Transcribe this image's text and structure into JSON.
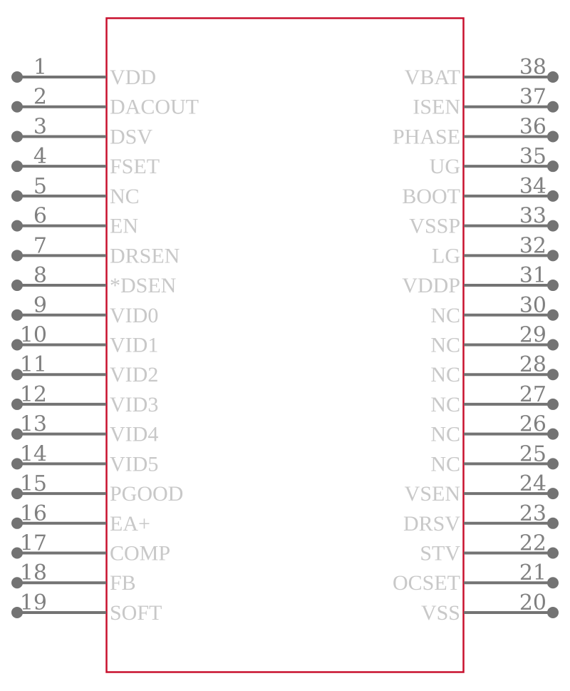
{
  "component": {
    "body_color": "#c8102e",
    "pin_color": "#737373",
    "label_color": "#c8c8c8",
    "left_pins": [
      {
        "number": "1",
        "name": "VDD"
      },
      {
        "number": "2",
        "name": "DACOUT"
      },
      {
        "number": "3",
        "name": "DSV"
      },
      {
        "number": "4",
        "name": "FSET"
      },
      {
        "number": "5",
        "name": "NC"
      },
      {
        "number": "6",
        "name": "EN"
      },
      {
        "number": "7",
        "name": "DRSEN"
      },
      {
        "number": "8",
        "name": "*DSEN"
      },
      {
        "number": "9",
        "name": "VID0"
      },
      {
        "number": "10",
        "name": "VID1"
      },
      {
        "number": "11",
        "name": "VID2"
      },
      {
        "number": "12",
        "name": "VID3"
      },
      {
        "number": "13",
        "name": "VID4"
      },
      {
        "number": "14",
        "name": "VID5"
      },
      {
        "number": "15",
        "name": "PGOOD"
      },
      {
        "number": "16",
        "name": "EA+"
      },
      {
        "number": "17",
        "name": "COMP"
      },
      {
        "number": "18",
        "name": "FB"
      },
      {
        "number": "19",
        "name": "SOFT"
      }
    ],
    "right_pins": [
      {
        "number": "38",
        "name": "VBAT"
      },
      {
        "number": "37",
        "name": "ISEN"
      },
      {
        "number": "36",
        "name": "PHASE"
      },
      {
        "number": "35",
        "name": "UG"
      },
      {
        "number": "34",
        "name": "BOOT"
      },
      {
        "number": "33",
        "name": "VSSP"
      },
      {
        "number": "32",
        "name": "LG"
      },
      {
        "number": "31",
        "name": "VDDP"
      },
      {
        "number": "30",
        "name": "NC"
      },
      {
        "number": "29",
        "name": "NC"
      },
      {
        "number": "28",
        "name": "NC"
      },
      {
        "number": "27",
        "name": "NC"
      },
      {
        "number": "26",
        "name": "NC"
      },
      {
        "number": "25",
        "name": "NC"
      },
      {
        "number": "24",
        "name": "VSEN"
      },
      {
        "number": "23",
        "name": "DRSV"
      },
      {
        "number": "22",
        "name": "STV"
      },
      {
        "number": "21",
        "name": "OCSET"
      },
      {
        "number": "20",
        "name": "VSS"
      }
    ]
  }
}
